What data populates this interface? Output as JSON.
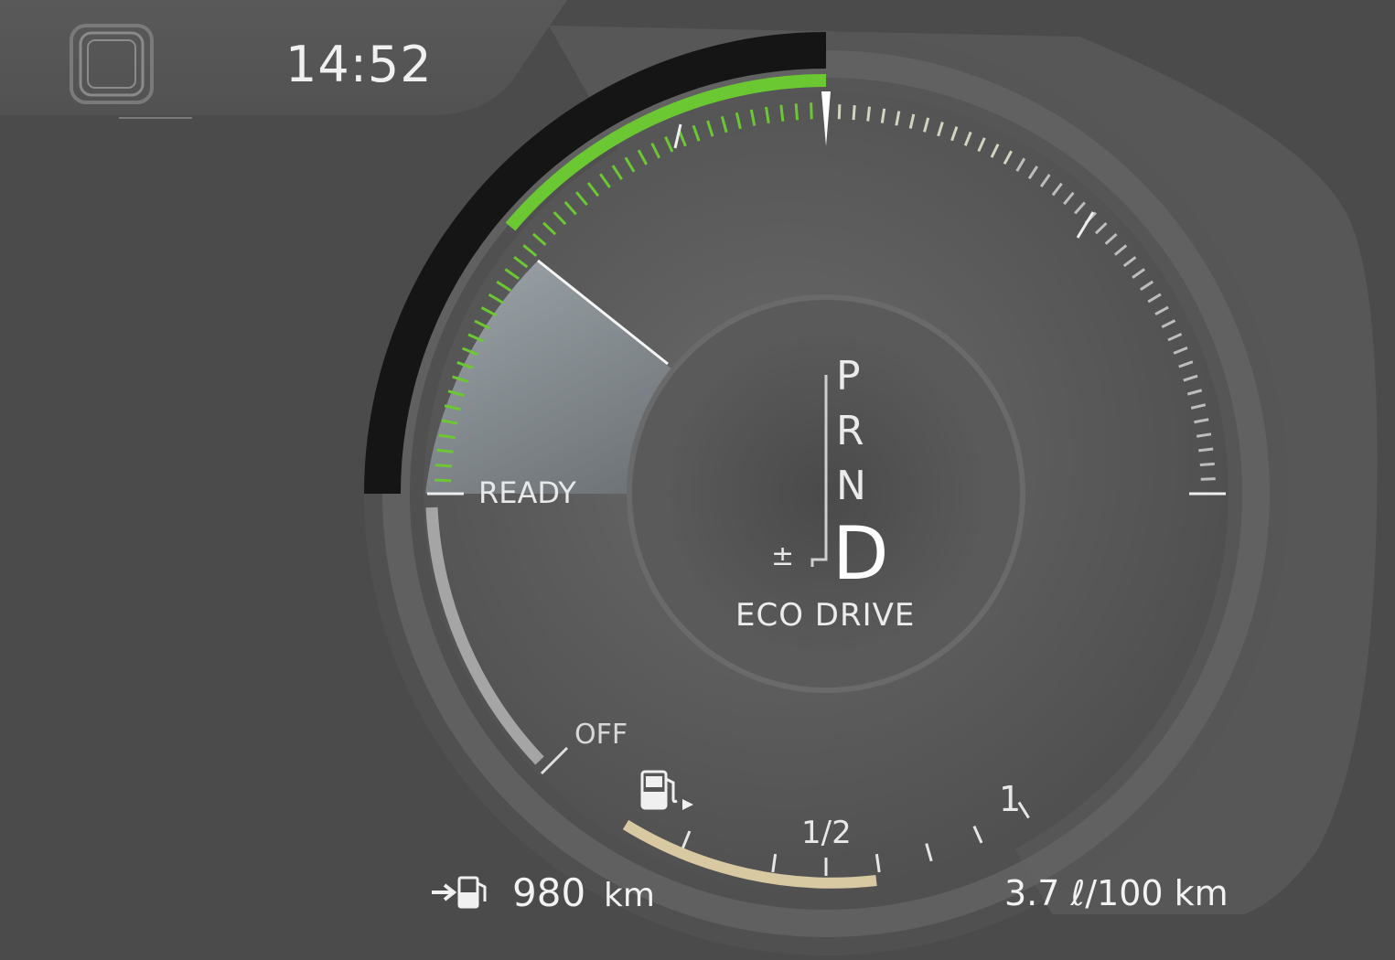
{
  "status_bar": {
    "clock": "14:52",
    "menu_icon": "app-view-icon"
  },
  "power_gauge": {
    "ready_label": "READY",
    "off_label": "OFF",
    "level": 0.3,
    "accent_color": "#6cc832"
  },
  "gear_selector": {
    "gears": [
      "P",
      "R",
      "N",
      "D"
    ],
    "selected": "D",
    "manual_symbol": "±",
    "drive_mode": "ECO DRIVE"
  },
  "fuel_gauge": {
    "icon": "fuel-pump-icon",
    "half_label": "1/2",
    "full_label": "1",
    "level": 0.5,
    "fill_color": "#d8c9a3"
  },
  "trip": {
    "range_icon": "range-to-empty-icon",
    "range_value": "980",
    "range_unit": "km",
    "consumption": "3.7 ℓ/100 km"
  }
}
